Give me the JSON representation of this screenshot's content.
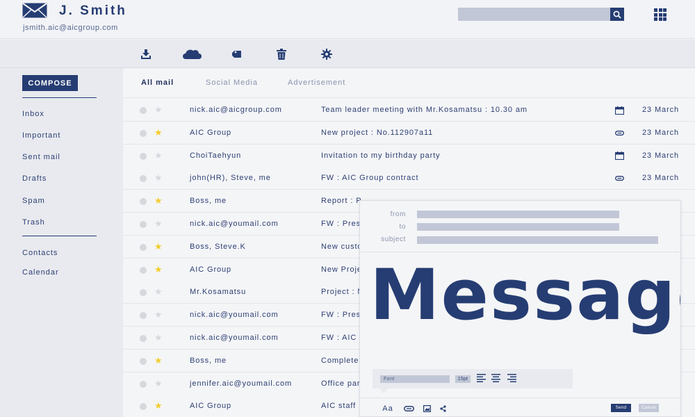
{
  "header": {
    "user_name": "J. Smith",
    "user_email": "jsmith.aic@aicgroup.com",
    "icons": [
      "envelope-logo-icon",
      "search-icon",
      "apps-grid-icon"
    ]
  },
  "toolbar": {
    "icons": [
      "download-icon",
      "cloud-icon",
      "tag-icon",
      "trash-icon",
      "gear-icon"
    ]
  },
  "sidebar": {
    "compose_label": "COMPOSE",
    "items": [
      "Inbox",
      "Important",
      "Sent mail",
      "Drafts",
      "Spam",
      "Trash"
    ],
    "extra_items": [
      "Contacts",
      "Calendar"
    ]
  },
  "tabs": [
    "All mail",
    "Social Media",
    "Advertisement"
  ],
  "emails": [
    {
      "sender": "nick.aic@aicgroup.com",
      "subject": "Team leader meeting with Mr.Kosamatsu : 10.30 am",
      "starred": false,
      "icon": "calendar-icon",
      "date": "23 March"
    },
    {
      "sender": "AIC Group",
      "subject": "New project : No.112907a11",
      "starred": true,
      "icon": "paperclip-icon",
      "date": "23 March"
    },
    {
      "sender": "ChoiTaehyun",
      "subject": "Invitation to my birthday party",
      "starred": false,
      "icon": "calendar-icon",
      "date": "23 March"
    },
    {
      "sender": "john(HR), Steve, me",
      "subject": "FW : AIC Group contract",
      "starred": false,
      "icon": "paperclip-icon",
      "date": "23 March"
    },
    {
      "sender": "Boss, me",
      "subject": "Report : P",
      "starred": true,
      "icon": "",
      "date": ""
    },
    {
      "sender": "nick.aic@youmail.com",
      "subject": "FW : Press",
      "starred": false,
      "icon": "",
      "date": ""
    },
    {
      "sender": "Boss, Steve.K",
      "subject": "New custo",
      "starred": true,
      "icon": "",
      "date": ""
    },
    {
      "sender": "AIC Group",
      "subject": "New Proje",
      "starred": true,
      "icon": "",
      "date": ""
    },
    {
      "sender": "Mr.Kosamatsu",
      "subject": "Project : N",
      "starred": false,
      "icon": "",
      "date": ""
    },
    {
      "sender": "nick.aic@youmail.com",
      "subject": "FW : Press",
      "starred": false,
      "icon": "",
      "date": ""
    },
    {
      "sender": "nick.aic@youmail.com",
      "subject": "FW : AIC G",
      "starred": false,
      "icon": "",
      "date": ""
    },
    {
      "sender": "Boss, me",
      "subject": "Complete",
      "starred": true,
      "icon": "",
      "date": ""
    },
    {
      "sender": "jennifer.aic@youmail.com",
      "subject": "Office par",
      "starred": false,
      "icon": "",
      "date": ""
    },
    {
      "sender": "AIC Group",
      "subject": "AIC staff :",
      "starred": true,
      "icon": "",
      "date": ""
    }
  ],
  "compose_popup": {
    "from_label": "from",
    "to_label": "to",
    "subject_label": "subject",
    "message_text": "Message",
    "font_label": "Font",
    "font_size": "15pt",
    "format_icon_label": "Aa",
    "send_label": "Send",
    "cancel_label": "Cancel"
  },
  "colors": {
    "primary": "#263d73",
    "field_gray": "#c1c7d6",
    "star_on": "#f2cd2e",
    "star_off": "#d6d8de",
    "background": "#f2f3f6"
  }
}
